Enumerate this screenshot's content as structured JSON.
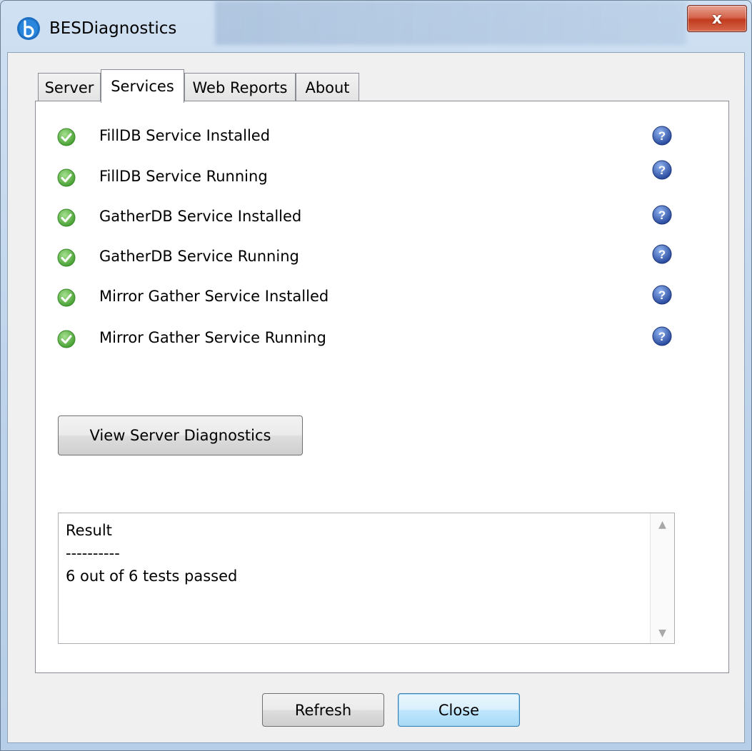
{
  "window": {
    "title": "BESDiagnostics",
    "close_label": "x"
  },
  "tabs": [
    {
      "label": "Server",
      "active": false
    },
    {
      "label": "Services",
      "active": true
    },
    {
      "label": "Web Reports",
      "active": false
    },
    {
      "label": "About",
      "active": false
    }
  ],
  "services": [
    {
      "label": "FillDB Service Installed",
      "status": "passed"
    },
    {
      "label": "FillDB Service Running",
      "status": "passed"
    },
    {
      "label": "GatherDB Service Installed",
      "status": "passed"
    },
    {
      "label": "GatherDB Service Running",
      "status": "passed"
    },
    {
      "label": "Mirror Gather Service Installed",
      "status": "passed"
    },
    {
      "label": "Mirror Gather Service Running",
      "status": "passed"
    }
  ],
  "view_diagnostics_label": "View Server Diagnostics",
  "result": {
    "heading": "Result",
    "separator": "----------",
    "summary": "6 out of 6 tests passed"
  },
  "buttons": {
    "refresh": "Refresh",
    "close": "Close"
  },
  "colors": {
    "check": "#4fae3c",
    "help": "#2a4fa8",
    "close_button": "#c9452a"
  }
}
